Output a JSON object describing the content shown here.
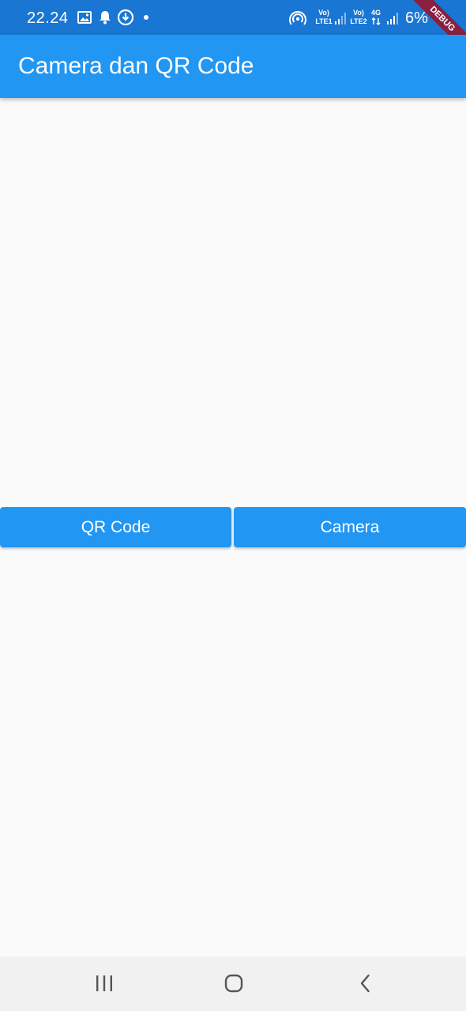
{
  "status_bar": {
    "time": "22.24",
    "icons": [
      "image-icon",
      "bell-icon",
      "download-circle-icon",
      "dot-icon",
      "hotspot-icon",
      "signal-lte1-icon",
      "signal-lte2-icon"
    ],
    "sim1_top": "Vo)",
    "sim1_bottom": "LTE1",
    "sim2_top": "Vo)",
    "sim2_bottom": "LTE2",
    "data_type": "4G",
    "battery": "6%"
  },
  "debug_banner": "DEBUG",
  "app_bar": {
    "title": "Camera dan QR Code"
  },
  "buttons": {
    "qr_code": "QR Code",
    "camera": "Camera"
  },
  "nav_bar": {
    "icons": [
      "recent-apps-icon",
      "home-icon",
      "back-icon"
    ]
  },
  "colors": {
    "status_bar": "#1976d2",
    "primary": "#2196f3",
    "background": "#fafafa",
    "nav_bar": "#f1f1f1",
    "debug_banner": "#8a1f3f"
  }
}
